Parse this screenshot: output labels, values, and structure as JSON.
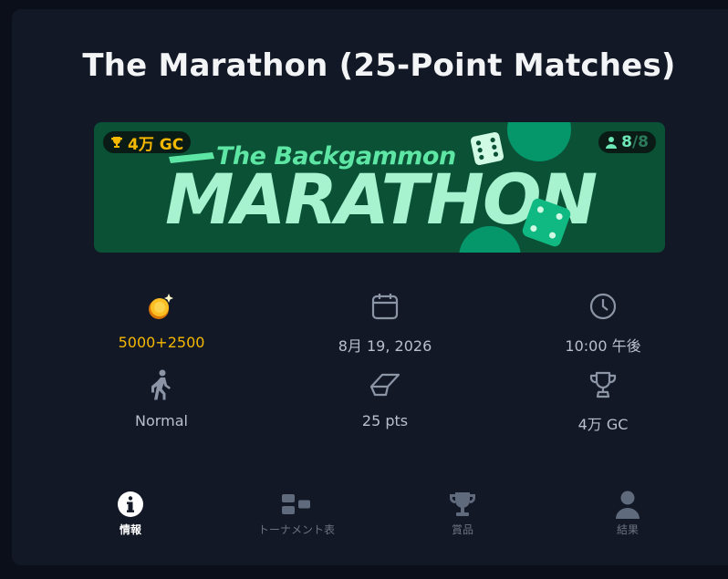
{
  "page": {
    "title": "The Marathon (25-Point Matches)"
  },
  "banner": {
    "prize": "4万 GC",
    "players_current": "8",
    "players_separator": "/",
    "players_max": "8",
    "subtitle": "The Backgammon",
    "headline": "MARATHON"
  },
  "stats": {
    "entry_fee": "5000+2500",
    "date": "8月 19, 2026",
    "time": "10:00 午後",
    "mode": "Normal",
    "points": "25 pts",
    "prize": "4万 GC"
  },
  "tabs": [
    {
      "label": "情報",
      "icon": "info-icon",
      "active": true
    },
    {
      "label": "トーナメント表",
      "icon": "bracket-icon",
      "active": false
    },
    {
      "label": "賞品",
      "icon": "trophy-icon",
      "active": false
    },
    {
      "label": "結果",
      "icon": "person-icon",
      "active": false
    }
  ],
  "colors": {
    "gold": "#f5b800",
    "banner": "#0a5136",
    "accent": "#5ee6a4"
  }
}
